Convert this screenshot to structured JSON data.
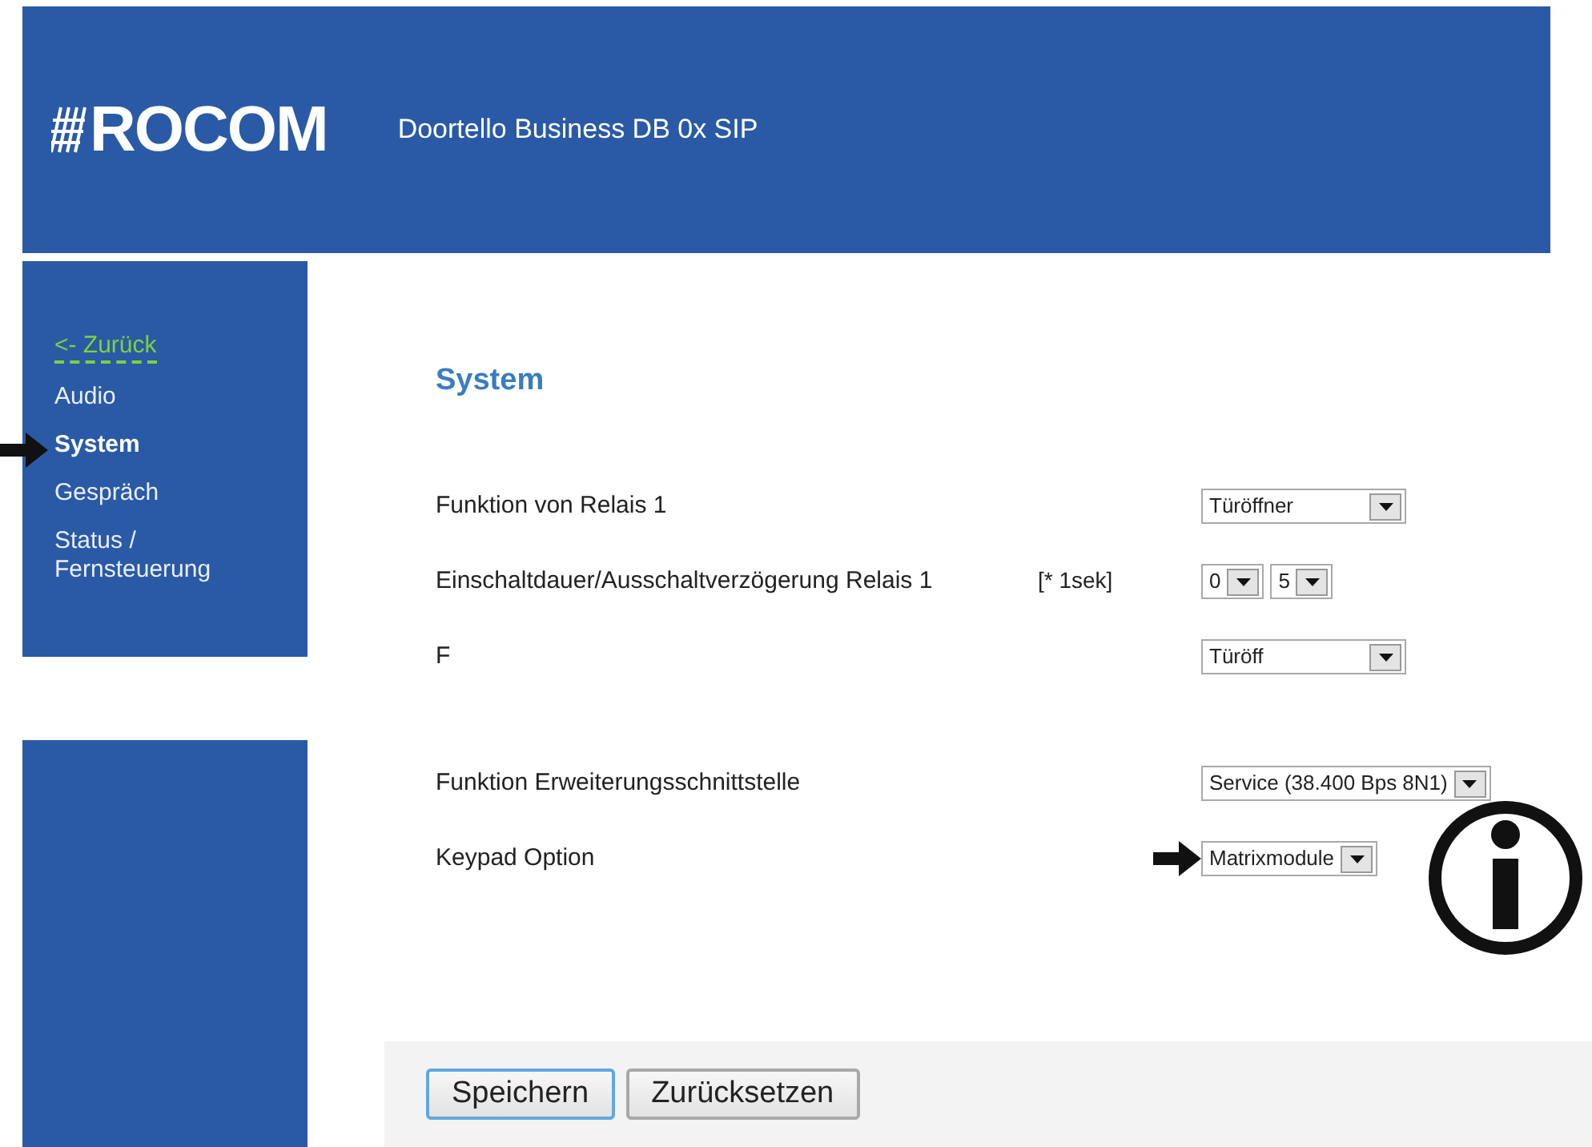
{
  "header": {
    "logo": "ROCOM",
    "title": "Doortello Business DB 0x SIP"
  },
  "sidebar": {
    "items": [
      {
        "label": "<- Zurück",
        "kind": "back",
        "selected": false
      },
      {
        "label": "Audio",
        "kind": "page",
        "selected": false
      },
      {
        "label": "System",
        "kind": "page",
        "selected": true
      },
      {
        "label": "Gespräch",
        "kind": "page",
        "selected": false
      },
      {
        "label": "Status / Fernsteuerung",
        "kind": "page",
        "selected": false
      }
    ]
  },
  "content": {
    "title": "System",
    "rows_top": [
      {
        "label": "Funktion von Relais 1",
        "selects": [
          "Türöffner"
        ],
        "pointed": false
      },
      {
        "label": "Einschaltdauer/Ausschaltverzögerung Relais 1",
        "unit": "[* 1sek]",
        "selects": [
          "0",
          "5"
        ],
        "pointed": false
      },
      {
        "label": "F",
        "selects": [
          "Türöff"
        ],
        "pointed": false
      }
    ],
    "rows_bottom": [
      {
        "label": "Funktion Erweiterungsschnittstelle",
        "selects": [
          "Service (38.400 Bps 8N1)"
        ],
        "pointed": false
      },
      {
        "label": "Keypad Option",
        "selects": [
          "Matrixmodule"
        ],
        "pointed": true
      }
    ]
  },
  "buttons": [
    {
      "label": "Speichern",
      "focused": true
    },
    {
      "label": "Zurücksetzen",
      "focused": false
    }
  ]
}
